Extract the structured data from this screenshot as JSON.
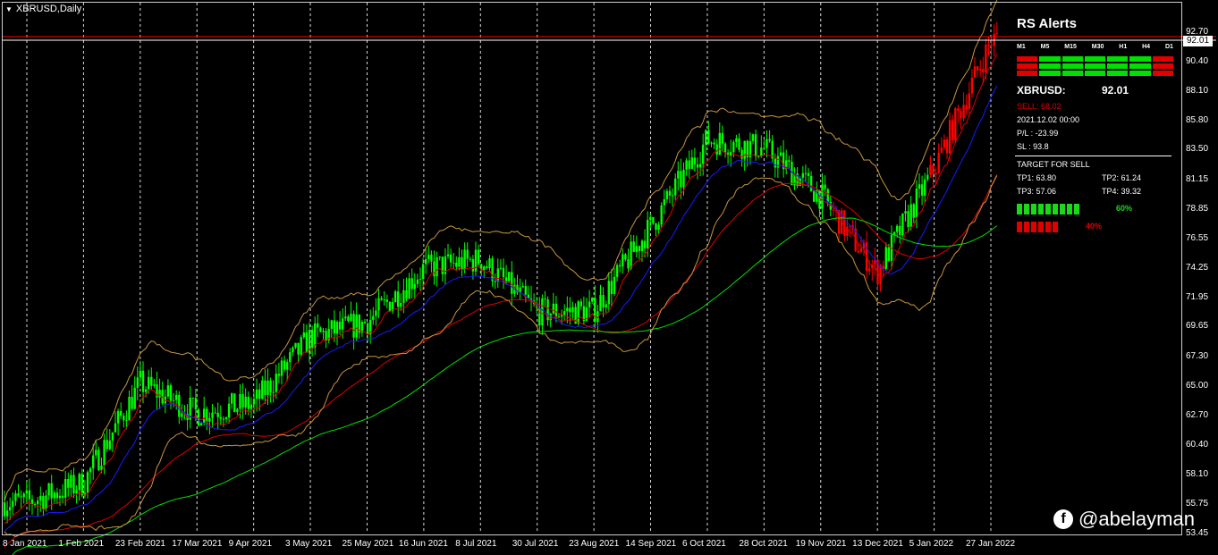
{
  "chart": {
    "symbol_label": "XBRUSD,Daily",
    "current_price_box": "92.01",
    "price_axis": [
      "92.70",
      "90.40",
      "88.10",
      "85.80",
      "83.50",
      "81.15",
      "78.85",
      "76.55",
      "74.25",
      "71.95",
      "69.65",
      "67.30",
      "65.00",
      "62.70",
      "60.40",
      "58.10",
      "55.75",
      "53.45"
    ],
    "date_axis": [
      "8 Jan 2021",
      "1 Feb 2021",
      "23 Feb 2021",
      "17 Mar 2021",
      "9 Apr 2021",
      "3 May 2021",
      "25 May 2021",
      "16 Jun 2021",
      "8 Jul 2021",
      "30 Jul 2021",
      "23 Aug 2021",
      "14 Sep 2021",
      "6 Oct 2021",
      "28 Oct 2021",
      "19 Nov 2021",
      "13 Dec 2021",
      "5 Jan 2022",
      "27 Jan 2022"
    ],
    "colors": {
      "bull": "#00ff00",
      "bear": "#ff0000",
      "ma_blue": "#1a1aff",
      "ma_red": "#e00000",
      "ma_green": "#00e000",
      "bands": "#c8963c",
      "grid": "#ffffff",
      "hline": "#ff0000",
      "indecision": "#b8d8e8"
    }
  },
  "chart_data": {
    "type": "candlestick",
    "close_series": [
      {
        "date": "8 Jan 2021",
        "close": 55.9
      },
      {
        "date": "1 Feb 2021",
        "close": 57.4
      },
      {
        "date": "23 Feb 2021",
        "close": 65.2
      },
      {
        "date": "17 Mar 2021",
        "close": 62.9
      },
      {
        "date": "9 Apr 2021",
        "close": 63.6
      },
      {
        "date": "3 May 2021",
        "close": 68.8
      },
      {
        "date": "25 May 2021",
        "close": 70.0
      },
      {
        "date": "16 Jun 2021",
        "close": 74.2
      },
      {
        "date": "8 Jul 2021",
        "close": 74.9
      },
      {
        "date": "30 Jul 2021",
        "close": 70.8
      },
      {
        "date": "23 Aug 2021",
        "close": 70.9
      },
      {
        "date": "14 Sep 2021",
        "close": 77.5
      },
      {
        "date": "6 Oct 2021",
        "close": 84.3
      },
      {
        "date": "28 Oct 2021",
        "close": 83.6
      },
      {
        "date": "19 Nov 2021",
        "close": 79.9
      },
      {
        "date": "13 Dec 2021",
        "close": 73.9
      },
      {
        "date": "5 Jan 2022",
        "close": 82.0
      },
      {
        "date": "27 Jan 2022",
        "close": 92.0
      }
    ],
    "y_range": [
      53.45,
      92.7
    ],
    "horizontal_lines": [
      93.8
    ],
    "grid": "vertical dashed"
  },
  "alerts": {
    "title": "RS Alerts",
    "timeframes": [
      "M1",
      "M5",
      "M15",
      "M30",
      "H1",
      "H4",
      "D1"
    ],
    "signal_rows": [
      [
        "#e00000",
        "#00e000",
        "#00e000",
        "#00e000",
        "#00e000",
        "#00e000",
        "#e00000"
      ],
      [
        "#e00000",
        "#00e000",
        "#00e000",
        "#00e000",
        "#00e000",
        "#00e000",
        "#e00000"
      ],
      [
        "#e00000",
        "#00e000",
        "#00e000",
        "#00e000",
        "#00e000",
        "#00e000",
        "#e00000"
      ]
    ],
    "pair": "XBRUSD:",
    "price": "92.01",
    "sell": "SELL: 68.02",
    "date": "2021.12.02 00:00",
    "pl": "P/L : -23.99",
    "sl": "SL : 93.8",
    "target_title": "TARGET FOR SELL",
    "tp1": "TP1: 63.80",
    "tp2": "TP2: 61.24",
    "tp3": "TP3: 57.06",
    "tp4": "TP4: 39.32",
    "green_pct": "60%",
    "red_pct": "40%",
    "green_fraction": 0.6,
    "red_fraction": 0.4
  },
  "watermark": {
    "icon": "facebook-icon",
    "text": "@abelayman"
  }
}
